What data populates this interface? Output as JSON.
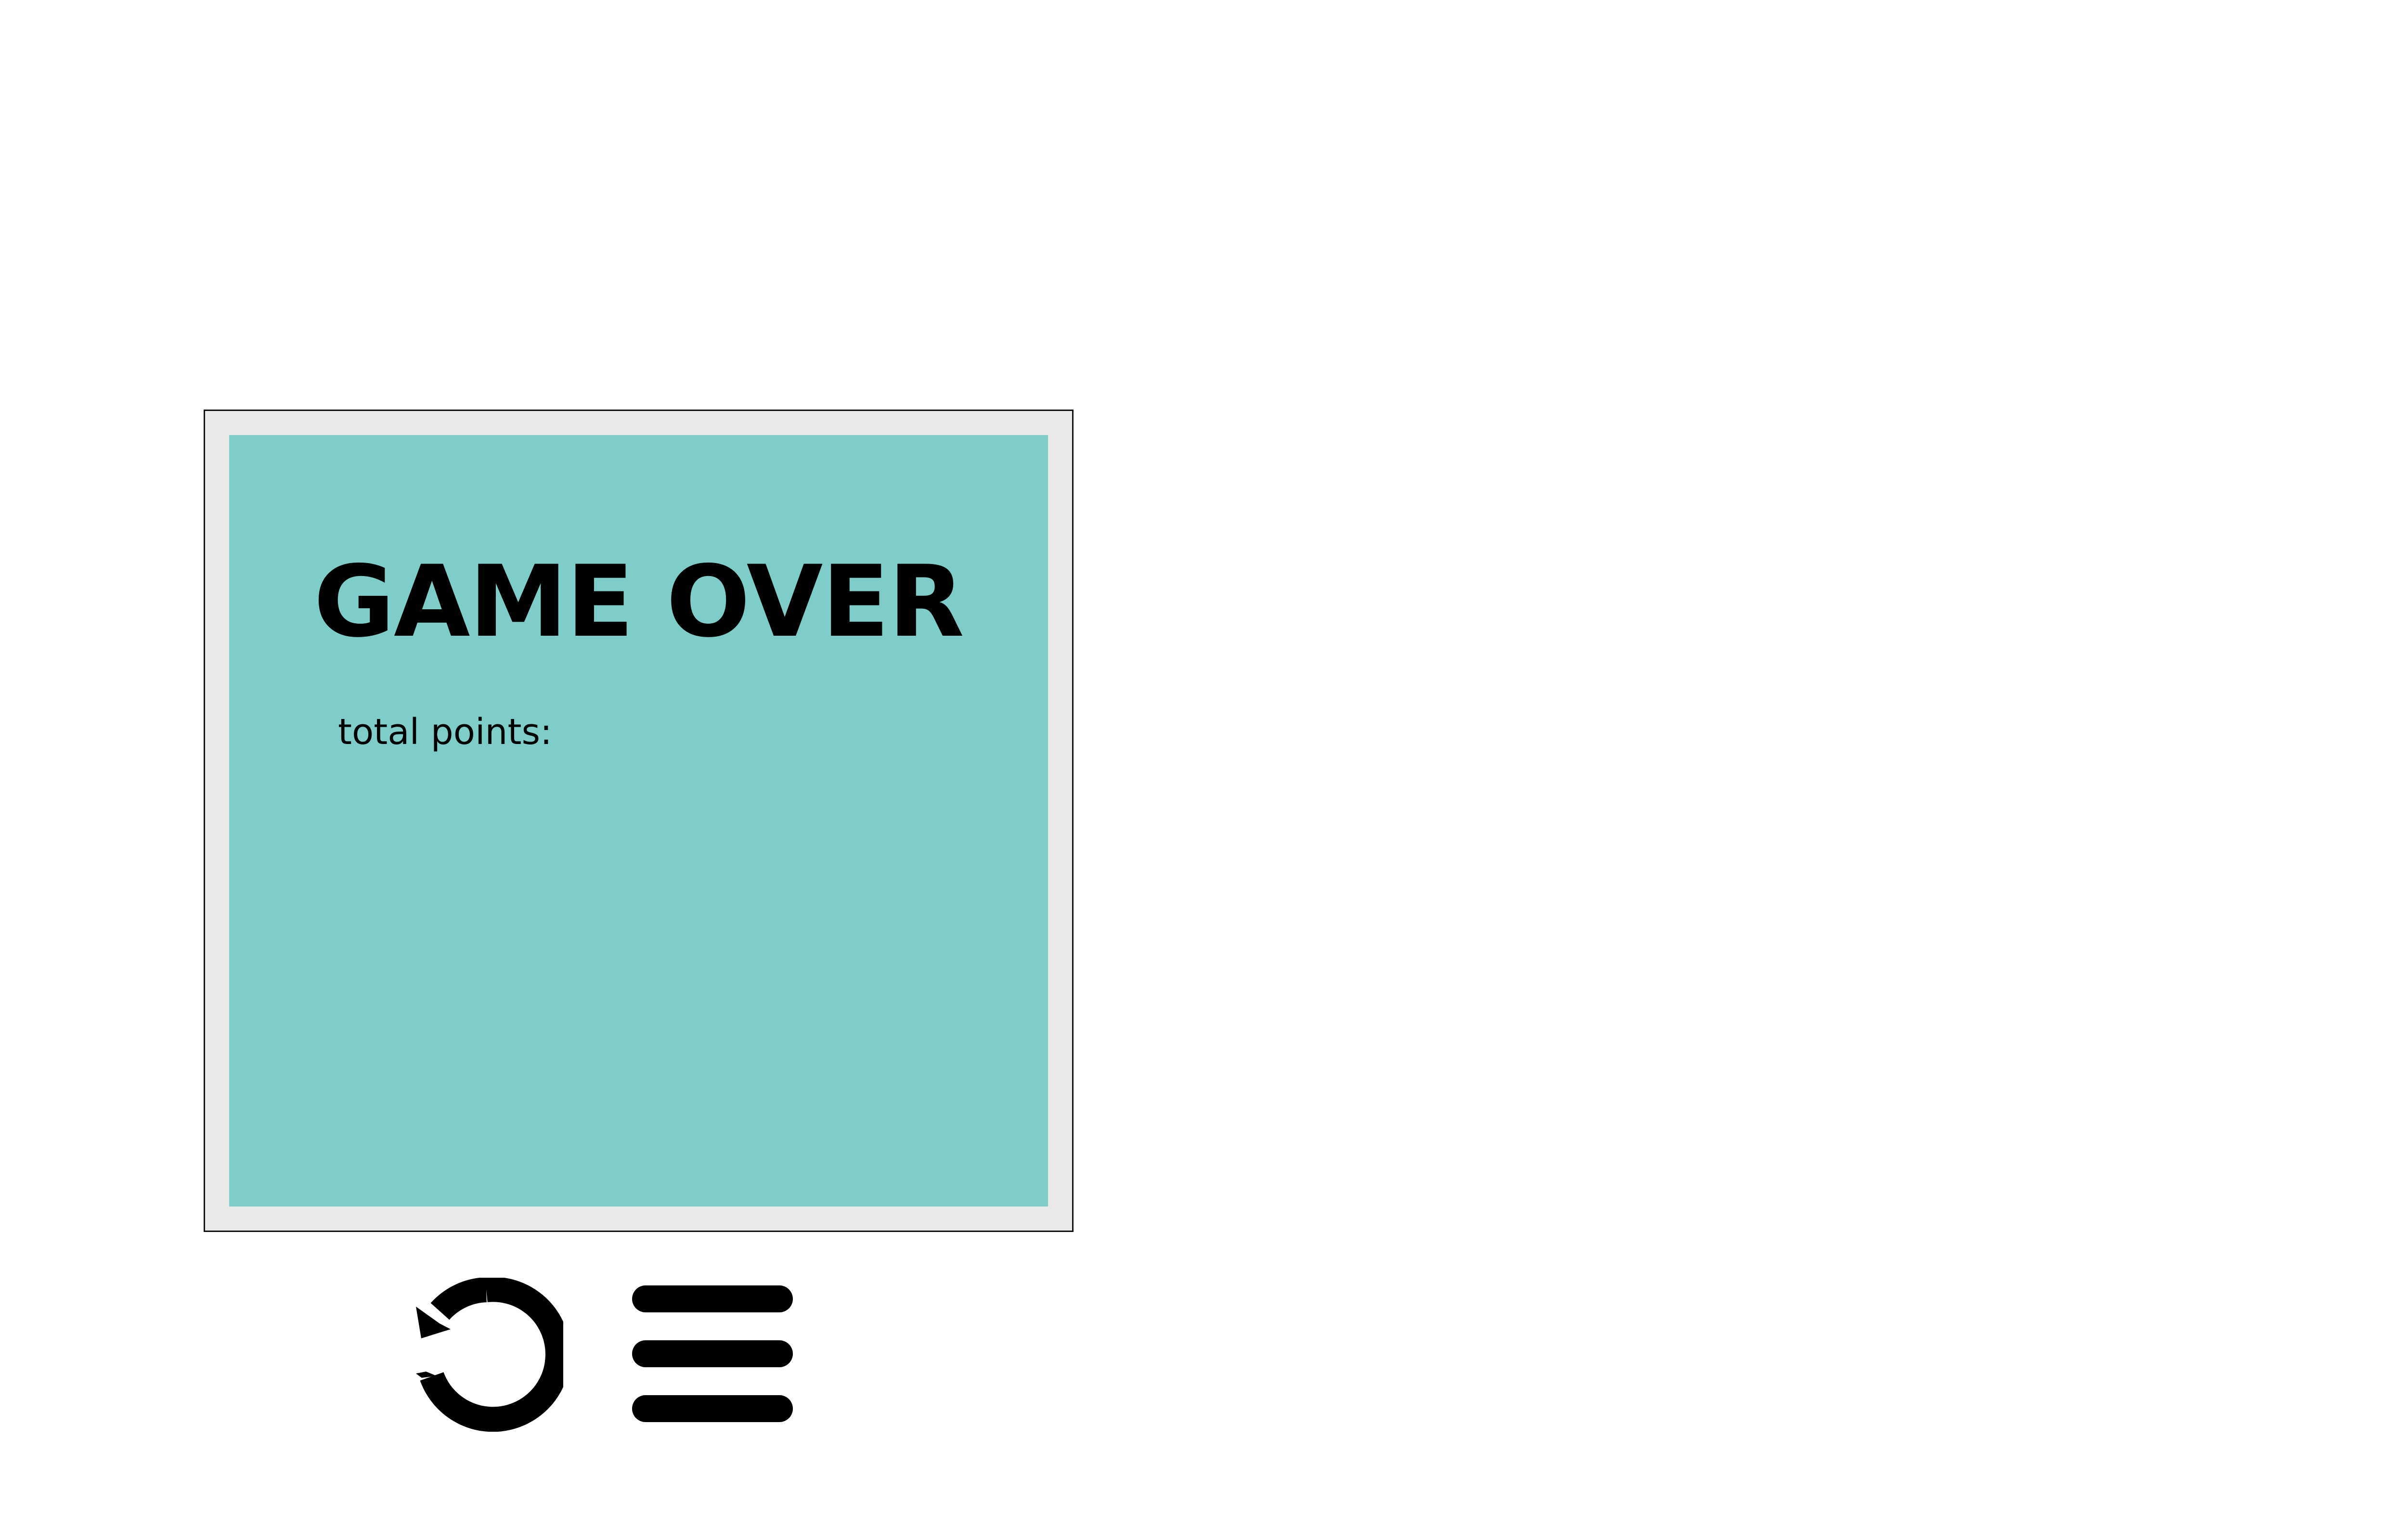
{
  "screen": {
    "title": "GAME OVER",
    "points_label": "total points:",
    "points_value": ""
  },
  "controls": {
    "restart_icon": "restart-icon",
    "menu_icon": "menu-icon"
  },
  "colors": {
    "panel": "#7ecdc8",
    "frame": "#e9e9e9",
    "text": "#000000"
  }
}
